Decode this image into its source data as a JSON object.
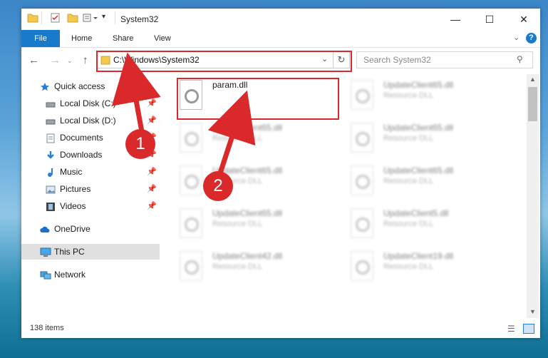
{
  "window": {
    "title": "System32",
    "minimize_icon": "minimize-icon",
    "maximize_icon": "maximize-icon",
    "close_icon": "close-icon"
  },
  "ribbon": {
    "tabs": [
      "File",
      "Home",
      "Share",
      "View"
    ],
    "help_label": "?"
  },
  "address": {
    "path": "C:\\Windows\\System32",
    "search_placeholder": "Search System32"
  },
  "sidebar": {
    "items": [
      {
        "label": "Quick access",
        "icon": "star-icon",
        "pinned": false
      },
      {
        "label": "Local Disk (C:)",
        "icon": "drive-icon",
        "pinned": true
      },
      {
        "label": "Local Disk (D:)",
        "icon": "drive-icon",
        "pinned": true
      },
      {
        "label": "Documents",
        "icon": "documents-icon",
        "pinned": true
      },
      {
        "label": "Downloads",
        "icon": "download-icon",
        "pinned": true
      },
      {
        "label": "Music",
        "icon": "music-icon",
        "pinned": true
      },
      {
        "label": "Pictures",
        "icon": "pictures-icon",
        "pinned": true
      },
      {
        "label": "Videos",
        "icon": "videos-icon",
        "pinned": true
      },
      {
        "label": "OneDrive",
        "icon": "cloud-icon",
        "pinned": false
      },
      {
        "label": "This PC",
        "icon": "computer-icon",
        "pinned": false,
        "selected": true
      },
      {
        "label": "Network",
        "icon": "network-icon",
        "pinned": false
      }
    ]
  },
  "files": [
    {
      "name": "param.dll",
      "type": ""
    },
    {
      "name": "UpdateClient65.dll",
      "type": "Resource DLL"
    },
    {
      "name": "UpdateClient65.dll",
      "type": "Resource DLL"
    },
    {
      "name": "UpdateClient65.dll",
      "type": "Resource DLL"
    },
    {
      "name": "UpdateClient65.dll",
      "type": "Resource DLL"
    },
    {
      "name": "UpdateClient65.dll",
      "type": "Resource DLL"
    },
    {
      "name": "UpdateClient65.dll",
      "type": "Resource DLL"
    },
    {
      "name": "UpdateClient5.dll",
      "type": "Resource DLL"
    },
    {
      "name": "UpdateClient42.dll",
      "type": "Resource DLL"
    },
    {
      "name": "UpdateClient19.dll",
      "type": "Resource DLL"
    }
  ],
  "status": {
    "item_count": "138 items"
  },
  "callouts": [
    "1",
    "2"
  ],
  "colors": {
    "accent": "#1979ca",
    "highlight_red": "#d9292b",
    "selected_bg": "#e0e0e0"
  }
}
